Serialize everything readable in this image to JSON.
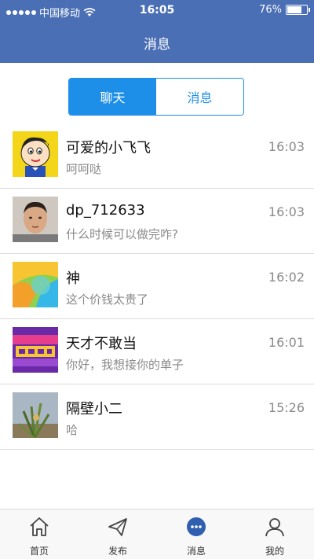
{
  "status_bar": {
    "carrier": "中国移动",
    "time": "16:05",
    "battery": "76%",
    "battery_level": 0.76
  },
  "header": {
    "title": "消息"
  },
  "segment": {
    "left": "聊天",
    "right": "消息"
  },
  "conversations": [
    {
      "name": "可爱的小飞飞",
      "preview": "呵呵哒",
      "time": "16:03"
    },
    {
      "name": "dp_712633",
      "preview": "什么时候可以做完咋?",
      "time": "16:03"
    },
    {
      "name": "神",
      "preview": "这个价钱太贵了",
      "time": "16:02"
    },
    {
      "name": "天才不敢当",
      "preview": "你好，我想接你的单子",
      "time": "16:01"
    },
    {
      "name": "隔壁小二",
      "preview": "哈",
      "time": "15:26"
    }
  ],
  "tabbar": {
    "home": "首页",
    "publish": "发布",
    "messages": "消息",
    "mine": "我的"
  },
  "colors": {
    "header": "#4a6fb5",
    "accent": "#1e8fe8"
  }
}
